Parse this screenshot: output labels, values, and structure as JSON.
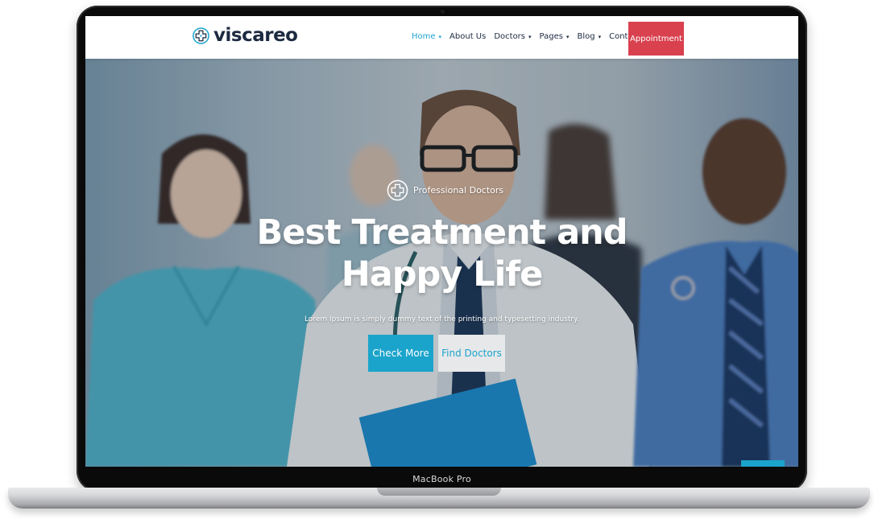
{
  "device": {
    "model_label": "MacBook Pro"
  },
  "site": {
    "logo_text": "viscareo",
    "logo_icon": "medical-cross-icon"
  },
  "nav": {
    "items": [
      {
        "label": "Home",
        "dropdown": true,
        "active": true
      },
      {
        "label": "About Us",
        "dropdown": false,
        "active": false
      },
      {
        "label": "Doctors",
        "dropdown": true,
        "active": false
      },
      {
        "label": "Pages",
        "dropdown": true,
        "active": false
      },
      {
        "label": "Blog",
        "dropdown": true,
        "active": false
      },
      {
        "label": "Contact Us",
        "dropdown": false,
        "active": false
      }
    ],
    "caret": "▾",
    "cta_label": "Appointment"
  },
  "hero": {
    "tagline": "Professional Doctors",
    "tagline_icon": "medical-cross-icon",
    "headline": "Best Treatment and Happy Life",
    "subtext": "Lorem Ipsum is simply dummy text of the printing and typesetting industry.",
    "primary_button": "Check More",
    "secondary_button": "Find Doctors"
  },
  "colors": {
    "accent_blue": "#1ba4cb",
    "cta_red": "#d9414f",
    "nav_text": "#1c2a40",
    "nav_active": "#1fa5cf"
  }
}
